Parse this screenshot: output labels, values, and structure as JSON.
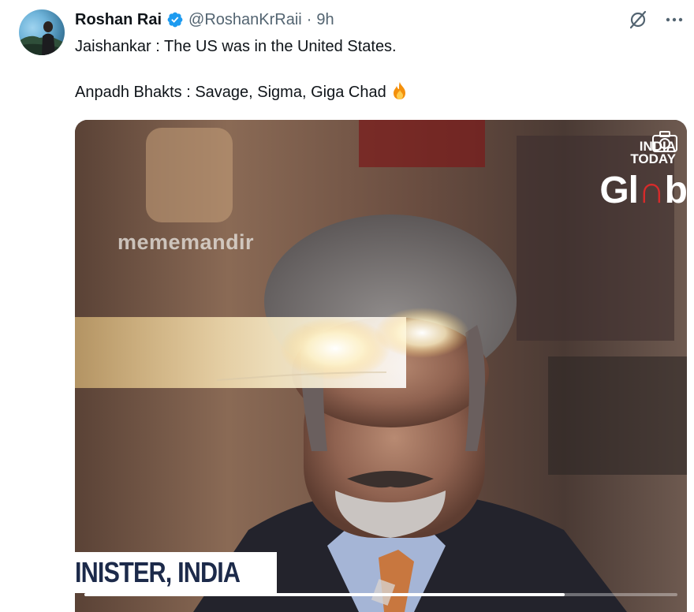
{
  "post": {
    "author_name": "Roshan Rai",
    "handle": "@RoshanKrRaii",
    "separator": "·",
    "timestamp": "9h",
    "text_line_1": "Jaishankar : The US was in the United States.",
    "text_line_2": "Anpadh Bhakts : Savage, Sigma, Giga Chad"
  },
  "icons": {
    "verified": "verified-badge-icon",
    "grok": "grok-icon",
    "more": "more-icon",
    "fire": "fire-emoji-icon"
  },
  "media": {
    "watermark": "memem andir",
    "watermark_text": "mememandir",
    "brand_line_1": "INDIA",
    "brand_line_2": "TODAY",
    "brand_glob_a": "Gl",
    "brand_glob_b": "b",
    "caption": "INISTER, INDIA",
    "progress": 0.81
  },
  "colors": {
    "verified_blue": "#1d9bf0",
    "text": "#0f1419",
    "secondary": "#536471"
  }
}
